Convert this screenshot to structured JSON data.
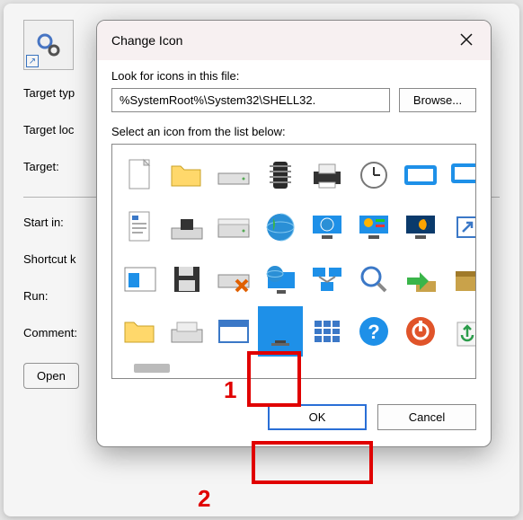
{
  "bg_window": {
    "fields": {
      "target_type": "Target typ",
      "target_location": "Target loc",
      "target": "Target:",
      "start_in": "Start in:",
      "shortcut_key": "Shortcut k",
      "run": "Run:",
      "comment": "Comment:"
    },
    "buttons": {
      "open": "Open"
    }
  },
  "dialog": {
    "title": "Change Icon",
    "label_look_for": "Look for icons in this file:",
    "path_value": "%SystemRoot%\\System32\\SHELL32.",
    "browse_label": "Browse...",
    "label_select": "Select an icon from the list below:",
    "ok_label": "OK",
    "cancel_label": "Cancel",
    "icons": [
      {
        "name": "blank-file-icon"
      },
      {
        "name": "folder-icon"
      },
      {
        "name": "drive-icon"
      },
      {
        "name": "chip-icon"
      },
      {
        "name": "printer-icon"
      },
      {
        "name": "clock-icon"
      },
      {
        "name": "window-icon"
      },
      {
        "name": "window-shortcut-icon"
      },
      {
        "name": "document-icon"
      },
      {
        "name": "floppy-drive-icon"
      },
      {
        "name": "hard-drive-icon"
      },
      {
        "name": "globe-icon"
      },
      {
        "name": "network-monitor-icon"
      },
      {
        "name": "control-panel-icon"
      },
      {
        "name": "night-mode-icon"
      },
      {
        "name": "shortcut-overlay-icon"
      },
      {
        "name": "window-layout-icon"
      },
      {
        "name": "save-icon"
      },
      {
        "name": "drive-error-icon"
      },
      {
        "name": "globe-monitor-icon"
      },
      {
        "name": "network-icon"
      },
      {
        "name": "search-icon"
      },
      {
        "name": "import-icon"
      },
      {
        "name": "package-icon"
      },
      {
        "name": "folder-alt-icon"
      },
      {
        "name": "external-drive-icon"
      },
      {
        "name": "program-window-icon"
      },
      {
        "name": "monitor-icon"
      },
      {
        "name": "grid-icon"
      },
      {
        "name": "help-icon"
      },
      {
        "name": "power-icon"
      },
      {
        "name": "recycle-icon"
      }
    ],
    "selected_icon_index": 27
  },
  "annotations": {
    "label1": "1",
    "label2": "2"
  }
}
